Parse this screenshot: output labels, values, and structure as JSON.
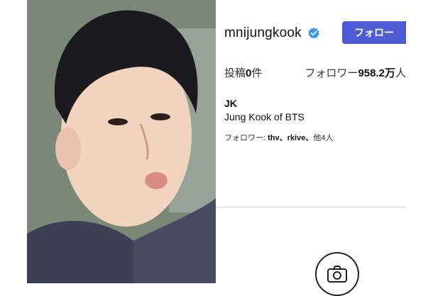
{
  "profile": {
    "username": "mnijungkook",
    "follow_label": "フォロー",
    "stats": {
      "posts_label": "投稿",
      "posts_value": "0",
      "posts_suffix": "件",
      "followers_label": "フォロワー",
      "followers_value": "958.2万",
      "followers_suffix": "人"
    },
    "bio": {
      "name": "JK",
      "description": "Jung Kook of BTS"
    },
    "followed_by": {
      "label": "フォロワー: ",
      "users": "thv、rkive、",
      "others": "他4人"
    }
  },
  "colors": {
    "accent": "#4f5bd5",
    "verified": "#3897f0"
  },
  "icons": {
    "verified": "verified-badge-icon",
    "camera": "camera-icon"
  }
}
